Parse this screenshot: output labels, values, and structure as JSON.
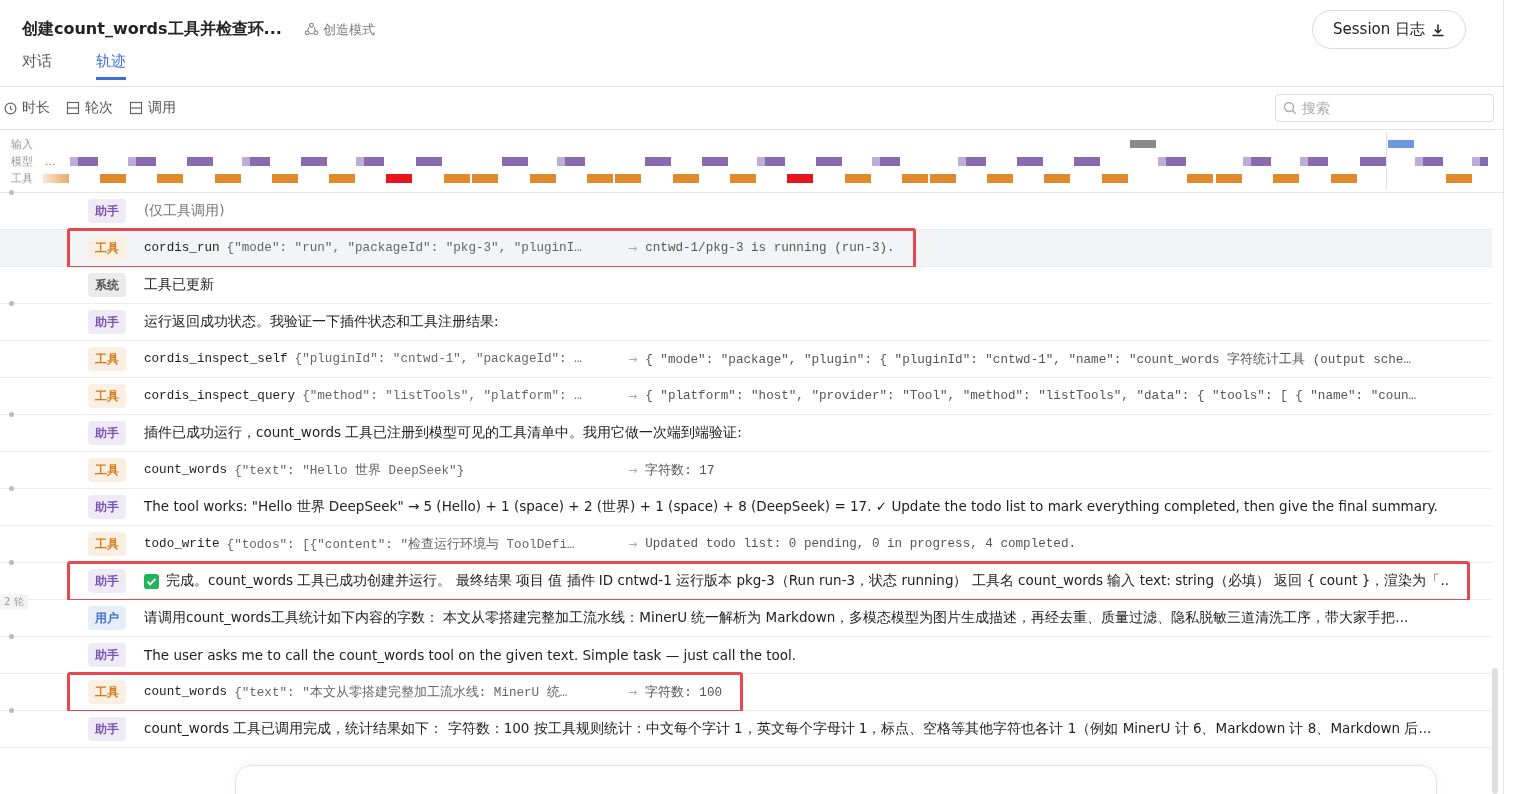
{
  "header": {
    "title": "创建count_words工具并检查环...",
    "mode": "创造模式",
    "session_button": "Session 日志"
  },
  "tabs": [
    {
      "label": "对话",
      "selected": false
    },
    {
      "label": "轨迹",
      "selected": true
    }
  ],
  "filters": [
    {
      "kind": "clock",
      "label": "时长"
    },
    {
      "kind": "panel",
      "label": "轮次"
    },
    {
      "kind": "panel",
      "label": "调用"
    }
  ],
  "search": {
    "placeholder": "搜索"
  },
  "timeline": {
    "lanes": [
      "输入",
      "模型",
      "工具"
    ],
    "more": "..."
  },
  "rows": [
    {
      "kind": "message",
      "color": "#7a55b0",
      "dot": true,
      "badge": "助手",
      "text": "(仅工具调用)",
      "muted": true,
      "selected": false,
      "highlighted": false
    },
    {
      "kind": "tool",
      "color": "#d67a16",
      "dot": false,
      "badge": "工具",
      "name": "cordis_run",
      "args": "{\"mode\": \"run\", \"packageId\": \"pkg-3\", \"pluginI…",
      "arrow": "→",
      "result": "cntwd-1/pkg-3 is running (run-3).",
      "selected": true,
      "highlighted": true
    },
    {
      "kind": "message",
      "color": "#555555",
      "dot": false,
      "badge": "系统",
      "text": "工具已更新",
      "muted": false,
      "selected": false,
      "highlighted": false
    },
    {
      "kind": "message",
      "color": "#7a55b0",
      "dot": true,
      "badge": "助手",
      "text": "运行返回成功状态。我验证一下插件状态和工具注册结果:",
      "muted": false,
      "selected": false,
      "highlighted": false
    },
    {
      "kind": "tool",
      "color": "#d67a16",
      "dot": false,
      "badge": "工具",
      "name": "cordis_inspect_self",
      "args": "{\"pluginId\": \"cntwd-1\", \"packageId\": …",
      "arrow": "→",
      "result": "{ \"mode\": \"package\", \"plugin\": { \"pluginId\": \"cntwd-1\", \"name\": \"count_words 字符统计工具 (output sche…",
      "selected": false,
      "highlighted": false
    },
    {
      "kind": "tool",
      "color": "#d67a16",
      "dot": false,
      "badge": "工具",
      "name": "cordis_inspect_query",
      "args": "{\"method\": \"listTools\", \"platform\": …",
      "arrow": "→",
      "result": "{ \"platform\": \"host\", \"provider\": \"Tool\", \"method\": \"listTools\", \"data\": { \"tools\": [ { \"name\": \"coun…",
      "selected": false,
      "highlighted": false
    },
    {
      "kind": "message",
      "color": "#7a55b0",
      "dot": true,
      "badge": "助手",
      "text": "插件已成功运行，count_words 工具已注册到模型可见的工具清单中。我用它做一次端到端验证:",
      "muted": false,
      "selected": false,
      "highlighted": false
    },
    {
      "kind": "tool",
      "color": "#d67a16",
      "dot": false,
      "badge": "工具",
      "name": "count_words",
      "args": "{\"text\": \"Hello 世界 DeepSeek\"}",
      "arrow": "→",
      "result": "字符数: 17",
      "selected": false,
      "highlighted": false
    },
    {
      "kind": "message",
      "color": "#7a55b0",
      "dot": true,
      "badge": "助手",
      "text": "The tool works: \"Hello 世界 DeepSeek\" → 5 (Hello) + 1 (space) + 2 (世界) + 1 (space) + 8 (DeepSeek) = 17. ✓ Update the todo list to mark everything completed, then give the final summary.",
      "muted": false,
      "selected": false,
      "highlighted": false
    },
    {
      "kind": "tool",
      "color": "#d67a16",
      "dot": false,
      "badge": "工具",
      "name": "todo_write",
      "args": "{\"todos\": [{\"content\": \"检查运行环境与 ToolDefi…",
      "arrow": "→",
      "result": "Updated todo list: 0 pending, 0 in progress, 4 completed.",
      "selected": false,
      "highlighted": false
    },
    {
      "kind": "done",
      "color": "#7a55b0",
      "dot": true,
      "badge": "助手",
      "text": "完成。count_words 工具已成功创建并运行。 最终结果 项目 值 插件 ID cntwd-1 运行版本 pkg-3（Run run-3，状态 running） 工具名 count_words 输入 text: string（必填） 返回 { count }，渲染为「..",
      "muted": false,
      "selected": false,
      "highlighted": true
    },
    {
      "kind": "message",
      "color": "#3d6fd0",
      "dot": false,
      "badge": "用户",
      "text": "请调用count_words工具统计如下内容的字数： 本文从零搭建完整加工流水线：MinerU 统一解析为 Markdown，多模态模型为图片生成描述，再经去重、质量过滤、隐私脱敏三道清洗工序，带大家手把...",
      "muted": false,
      "selected": false,
      "highlighted": false,
      "turn_label": "2 轮"
    },
    {
      "kind": "message",
      "color": "#7a55b0",
      "dot": true,
      "badge": "助手",
      "text": "The user asks me to call the count_words tool on the given text. Simple task — just call the tool.",
      "muted": false,
      "selected": false,
      "highlighted": false
    },
    {
      "kind": "tool",
      "color": "#d67a16",
      "dot": false,
      "badge": "工具",
      "name": "count_words",
      "args": "{\"text\": \"本文从零搭建完整加工流水线: MinerU 统…",
      "arrow": "→",
      "result": "字符数: 100",
      "selected": false,
      "highlighted": true
    },
    {
      "kind": "message",
      "color": "#7a55b0",
      "dot": true,
      "badge": "助手",
      "text": "count_words 工具已调用完成，统计结果如下： 字符数：100 按工具规则统计：中文每个字计 1，英文每个字母计 1，标点、空格等其他字符也各计 1（例如 MinerU 计 6、Markdown 计 8、Markdown 后...",
      "muted": false,
      "selected": false,
      "highlighted": false
    }
  ]
}
